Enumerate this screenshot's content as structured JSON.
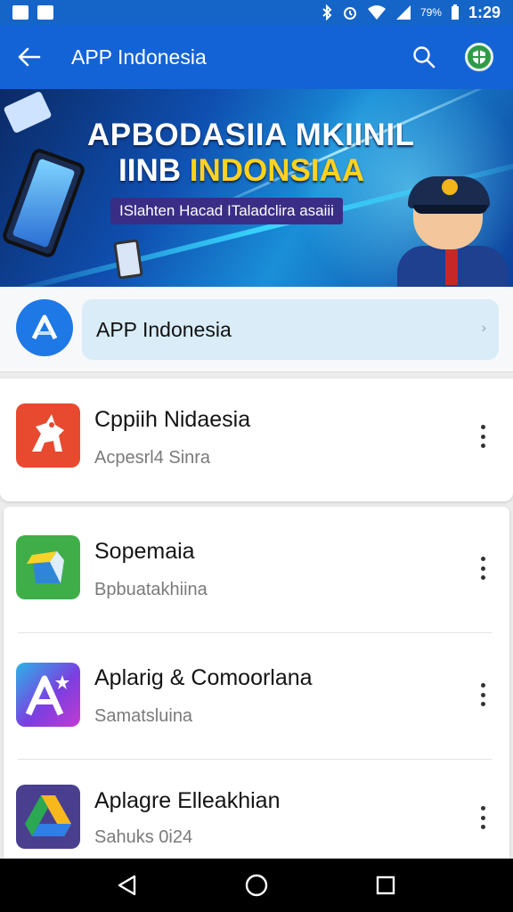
{
  "status_bar": {
    "time": "1:29",
    "battery_text": "79%",
    "icons": [
      "notification-icon",
      "sim-icon",
      "bluetooth-icon",
      "alarm-icon",
      "wifi-icon",
      "signal-icon",
      "battery-icon"
    ]
  },
  "app_bar": {
    "title": "APP Indonesia",
    "back_icon": "arrow-left-icon",
    "search_icon": "search-icon",
    "profile_icon": "account-avatar-icon"
  },
  "banner": {
    "line1": "APBODASIIA MKIINIL",
    "line2_white": "IINB",
    "line2_yellow": "INDONSIAA",
    "subtitle": "ISlahten Hacad ITaladclira asaiii"
  },
  "featured": {
    "label": "APP Indonesia",
    "logo_icon": "app-indonesia-logo-icon",
    "chevron_icon": "chevron-right-icon"
  },
  "apps": [
    {
      "title": "Cppiih Nidaesia",
      "subtitle": "Acpesrl4 Sinra",
      "icon": "red-horse-app-icon",
      "color": "#e84a2f"
    },
    {
      "title": "Sopemaia",
      "subtitle": "Bpbuatakhiina",
      "icon": "green-cube-app-icon",
      "color": "#3fae49"
    },
    {
      "title": "Aplarig & Comoorlana",
      "subtitle": "Samatsluina",
      "icon": "purple-star-app-icon",
      "color": "#6b3fd6"
    },
    {
      "title": "Aplagre Elleakhian",
      "subtitle": "Sahuks 0i24",
      "icon": "drive-triangle-app-icon",
      "color": "#4a3f8f"
    }
  ],
  "nav": {
    "back": "nav-back-icon",
    "home": "nav-home-icon",
    "recents": "nav-recents-icon"
  },
  "colors": {
    "app_bar": "#1463d6",
    "status_bar": "#1565c8",
    "featured_pill": "#d9ecf7",
    "banner_yellow": "#ffd21f"
  }
}
